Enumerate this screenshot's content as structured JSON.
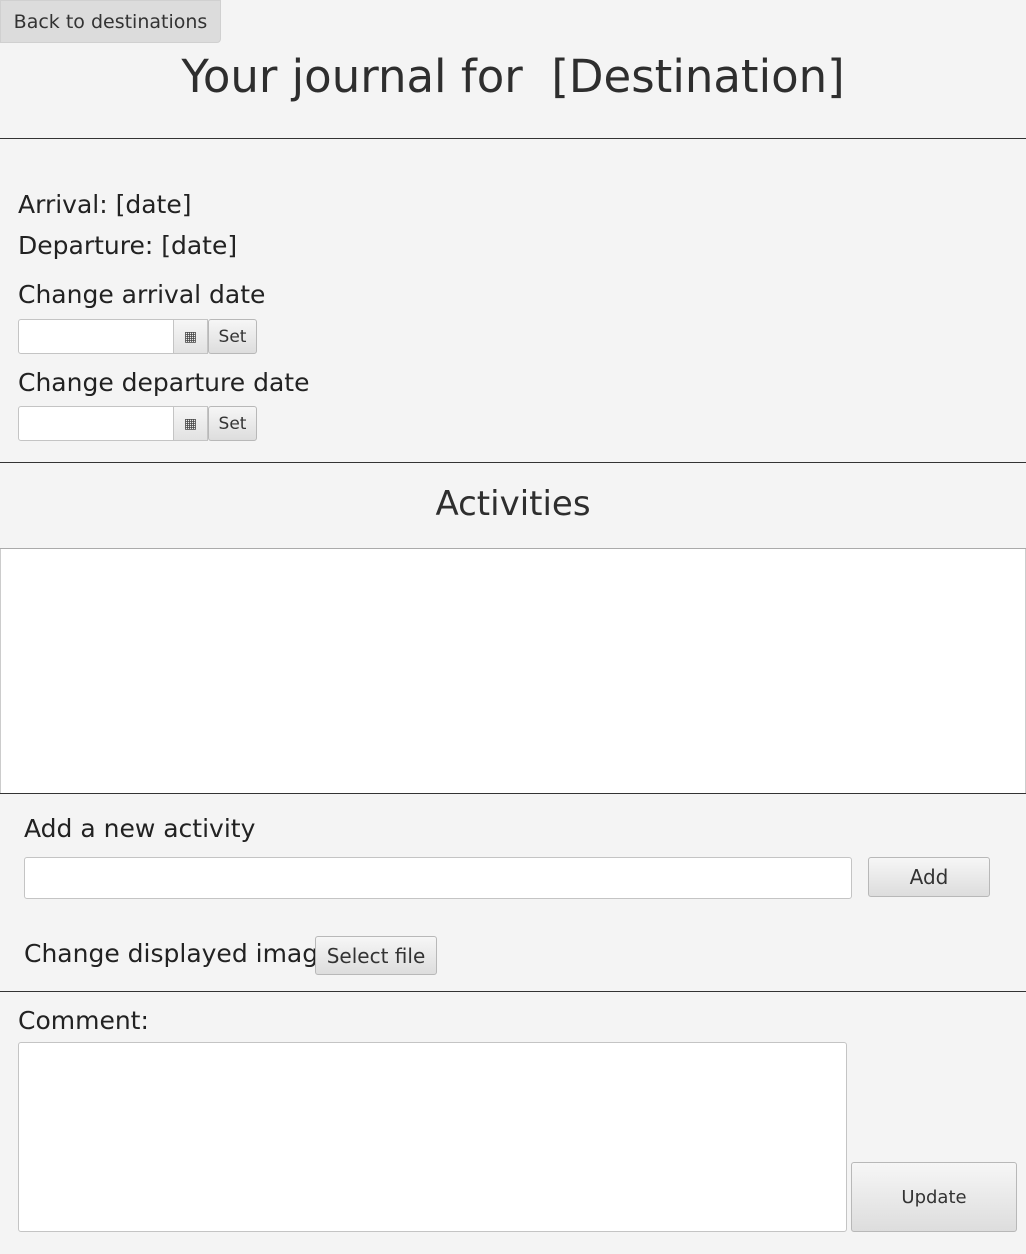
{
  "header": {
    "back_label": "Back to destinations",
    "title": "Your journal for",
    "destination": "[Destination]"
  },
  "dates": {
    "arrival_label": "Arrival:",
    "arrival_value": "[date]",
    "departure_label": "Departure:",
    "departure_value": "[date]",
    "change_arrival_label": "Change arrival date",
    "change_departure_label": "Change departure date",
    "set_label": "Set",
    "arrival_input_value": "",
    "departure_input_value": ""
  },
  "activities": {
    "heading": "Activities",
    "items": [],
    "add_label": "Add a new activity",
    "add_input_value": "",
    "add_button": "Add"
  },
  "image": {
    "label": "Change displayed image",
    "select_button": "Select file"
  },
  "comment": {
    "label": "Comment:",
    "value": "",
    "update_button": "Update"
  },
  "icons": {
    "calendar": "calendar-icon"
  }
}
